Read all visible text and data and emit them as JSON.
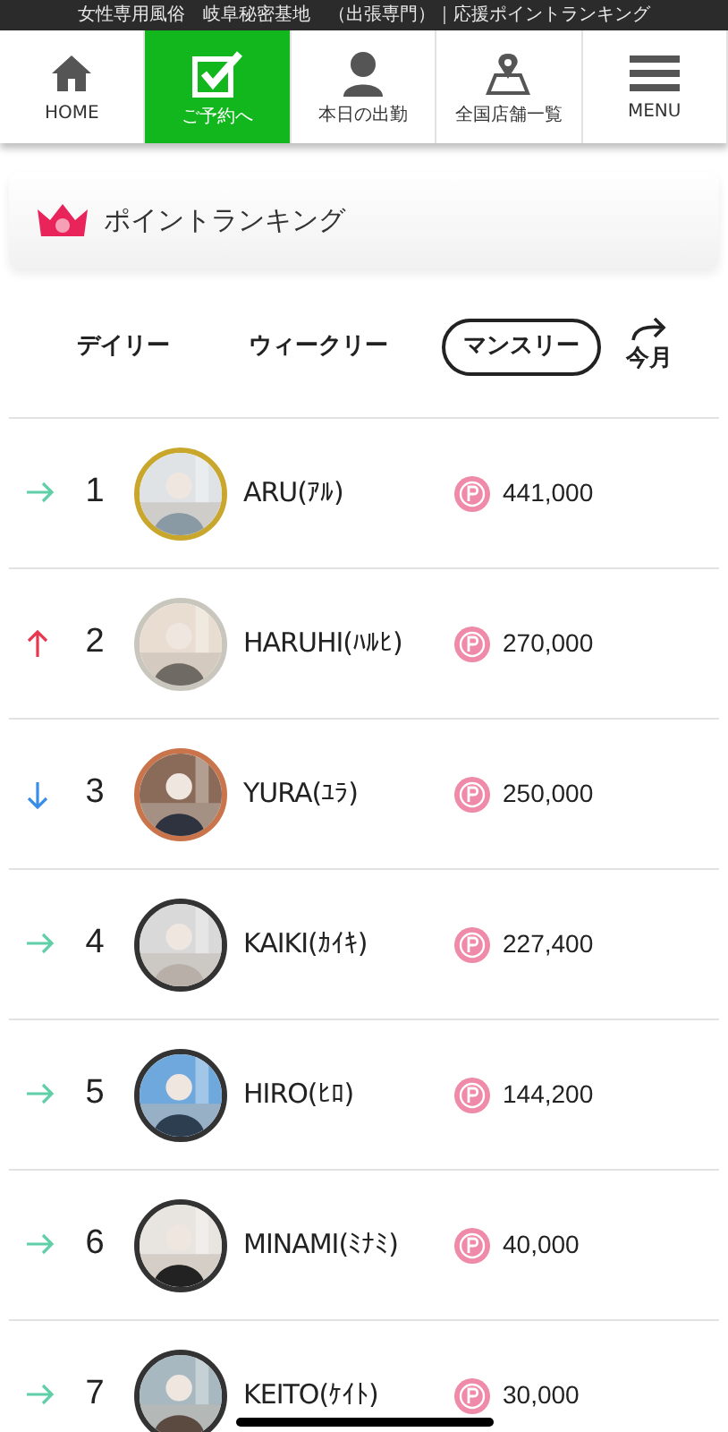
{
  "top_bar": {
    "title": "女性専用風俗　岐阜秘密基地　（出張専門）｜応援ポイントランキング"
  },
  "nav": [
    {
      "kind": "home",
      "label": "HOME",
      "selected": false
    },
    {
      "kind": "reserve",
      "label": "ご予約へ",
      "selected": true
    },
    {
      "kind": "person",
      "label": "本日の出勤",
      "selected": false
    },
    {
      "kind": "map",
      "label": "全国店舗一覧",
      "selected": false
    },
    {
      "kind": "menu",
      "label": "MENU",
      "selected": false
    }
  ],
  "heading": {
    "title": "ポイントランキング"
  },
  "tabs": [
    {
      "label": "デイリー",
      "selected": false
    },
    {
      "label": "ウィークリー",
      "selected": false
    },
    {
      "label": "マンスリー",
      "selected": true
    }
  ],
  "period_link": {
    "label": "今月"
  },
  "rankings": [
    {
      "kind": "same",
      "rank": "1",
      "name": "ARU(ｱﾙ)",
      "points": "441,000",
      "color": "#c9a62c"
    },
    {
      "kind": "up",
      "rank": "2",
      "name": "HARUHI(ﾊﾙﾋ)",
      "points": "270,000",
      "color": "#c8c6bd"
    },
    {
      "kind": "down",
      "rank": "3",
      "name": "YURA(ﾕﾗ)",
      "points": "250,000",
      "color": "#c9744a"
    },
    {
      "kind": "same",
      "rank": "4",
      "name": "KAIKI(ｶｲｷ)",
      "points": "227,400",
      "color": "#333333"
    },
    {
      "kind": "same",
      "rank": "5",
      "name": "HIRO(ﾋﾛ)",
      "points": "144,200",
      "color": "#333333"
    },
    {
      "kind": "same",
      "rank": "6",
      "name": "MINAMI(ﾐﾅﾐ)",
      "points": "40,000",
      "color": "#333333"
    },
    {
      "kind": "same",
      "rank": "7",
      "name": "KEITO(ｹｲﾄ)",
      "points": "30,000",
      "color": "#333333"
    }
  ]
}
